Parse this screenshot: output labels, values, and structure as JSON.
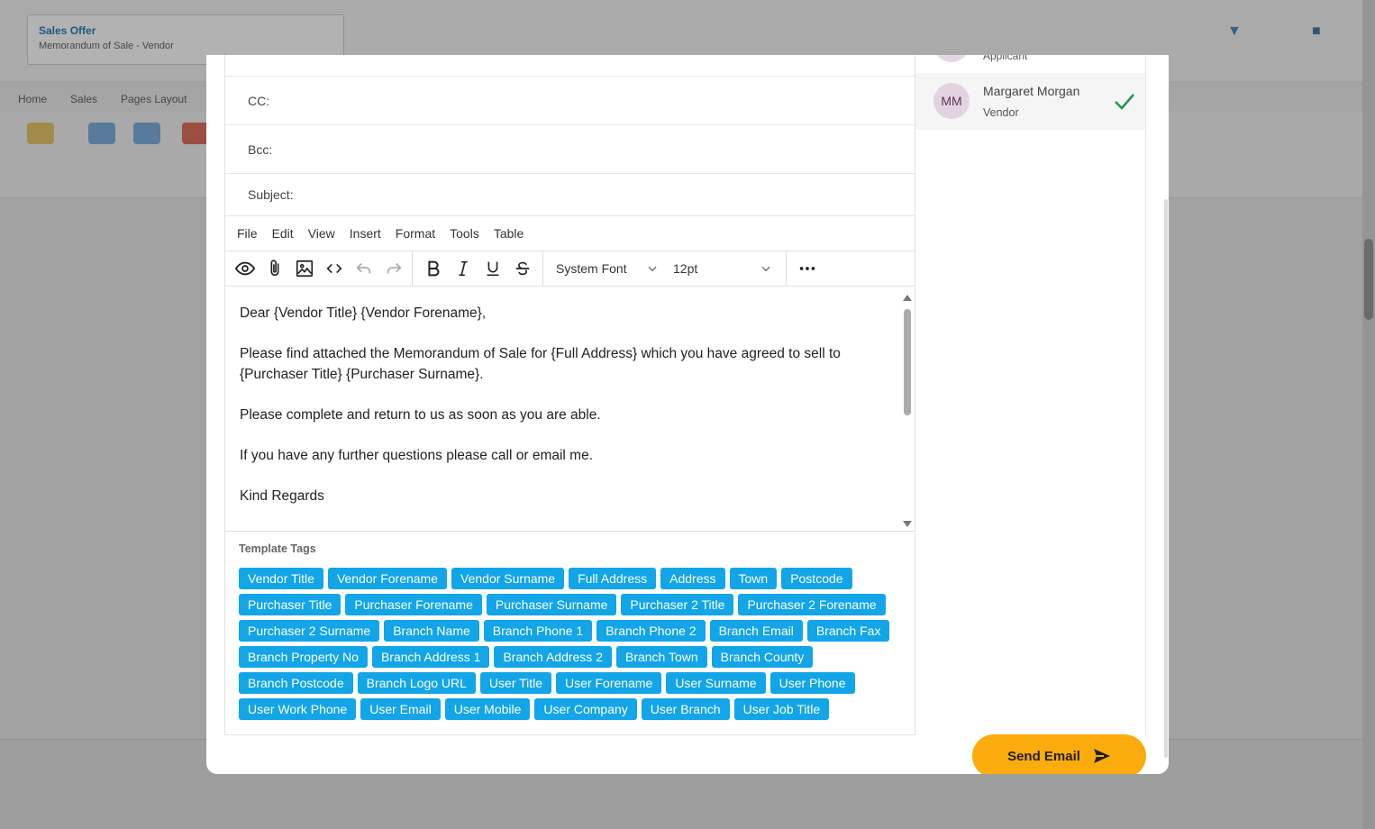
{
  "background": {
    "card_title": "Sales Offer",
    "card_subtitle": "Memorandum of Sale - Vendor",
    "ribbon_tabs": [
      "Home",
      "Sales",
      "Pages Layout"
    ]
  },
  "fields": {
    "cc_label": "CC:",
    "bcc_label": "Bcc:",
    "subject_label": "Subject:"
  },
  "menu": [
    "File",
    "Edit",
    "View",
    "Insert",
    "Format",
    "Tools",
    "Table"
  ],
  "toolbar": {
    "font_family": "System Font",
    "font_size": "12pt"
  },
  "editor": {
    "paragraphs": [
      " Dear {Vendor Title} {Vendor Forename},",
      "Please find attached the Memorandum of Sale for  {Full Address} which you have agreed to sell to  {Purchaser Title} {Purchaser Surname}.",
      "Please complete and return to us as soon as you are able.",
      "If you have any further questions please call or email me.",
      "Kind Regards"
    ]
  },
  "tags_title": "Template Tags",
  "tags": [
    "Vendor Title",
    "Vendor Forename",
    "Vendor Surname",
    "Full Address",
    "Address",
    "Town",
    "Postcode",
    "Purchaser Title",
    "Purchaser Forename",
    "Purchaser Surname",
    "Purchaser 2 Title",
    "Purchaser 2 Forename",
    "Purchaser 2 Surname",
    "Branch Name",
    "Branch Phone 1",
    "Branch Phone 2",
    "Branch Email",
    "Branch Fax",
    "Branch Property No",
    "Branch Address 1",
    "Branch Address 2",
    "Branch Town",
    "Branch County",
    "Branch Postcode",
    "Branch Logo URL",
    "User Title",
    "User Forename",
    "User Surname",
    "User Phone",
    "User Work Phone",
    "User Email",
    "User Mobile",
    "User Company",
    "User Branch",
    "User Job Title"
  ],
  "recipients": {
    "previous_role": "Applicant",
    "selected": {
      "initials": "MM",
      "name": "Margaret Morgan",
      "role": "Vendor"
    }
  },
  "send_button": "Send Email",
  "colors": {
    "tag": "#12a5e8",
    "send": "#fcab0c",
    "check": "#1d9a4f"
  }
}
